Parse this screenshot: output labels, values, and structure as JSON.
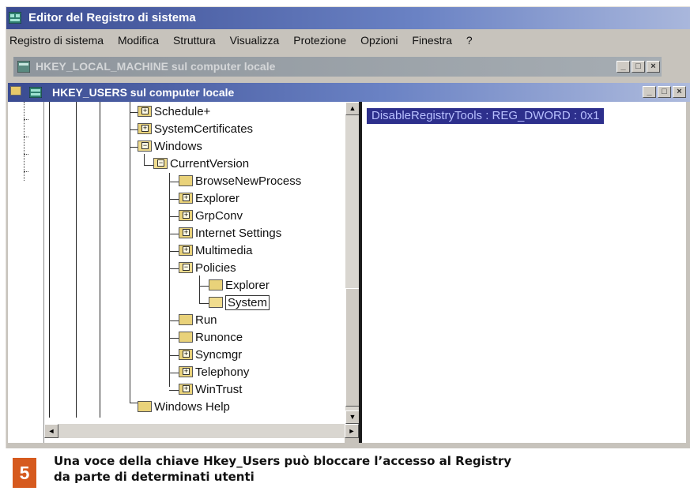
{
  "window": {
    "title": "Editor del Registro di sistema",
    "menu": [
      "Registro di sistema",
      "Modifica",
      "Struttura",
      "Visualizza",
      "Protezione",
      "Opzioni",
      "Finestra",
      "?"
    ]
  },
  "bg_window": {
    "title": "HKEY_LOCAL_MACHINE sul computer locale"
  },
  "fg_window": {
    "title": "HKEY_USERS sul computer locale"
  },
  "controls": {
    "minimize": "_",
    "maximize": "□",
    "close": "×"
  },
  "tree": [
    {
      "label": "Schedule+",
      "icon": "folder-plus-icon"
    },
    {
      "label": "SystemCertificates",
      "icon": "folder-plus-icon"
    },
    {
      "label": "Windows",
      "icon": "folder-open-icon"
    },
    {
      "label": "CurrentVersion",
      "icon": "folder-open-icon"
    },
    {
      "label": "BrowseNewProcess",
      "icon": "folder-icon"
    },
    {
      "label": "Explorer",
      "icon": "folder-icon"
    },
    {
      "label": "GrpConv",
      "icon": "folder-plus-icon"
    },
    {
      "label": "Internet Settings",
      "icon": "folder-plus-icon"
    },
    {
      "label": "Multimedia",
      "icon": "folder-plus-icon"
    },
    {
      "label": "Policies",
      "icon": "folder-open-icon"
    },
    {
      "label": "Explorer",
      "icon": "folder-icon"
    },
    {
      "label": "System",
      "icon": "folder-open-icon",
      "selected": true
    },
    {
      "label": "Run",
      "icon": "folder-icon"
    },
    {
      "label": "Runonce",
      "icon": "folder-icon"
    },
    {
      "label": "Syncmgr",
      "icon": "folder-plus-icon"
    },
    {
      "label": "Telephony",
      "icon": "folder-plus-icon"
    },
    {
      "label": "WinTrust",
      "icon": "folder-plus-icon"
    },
    {
      "label": "Windows Help",
      "icon": "folder-icon"
    }
  ],
  "values": [
    {
      "text": "DisableRegistryTools : REG_DWORD : 0x1",
      "selected": true
    }
  ],
  "scroll": {
    "up": "▲",
    "down": "▼",
    "left": "◄",
    "right": "►"
  },
  "caption": {
    "number": "5",
    "line1": "Una voce della chiave Hkey_Users può bloccare l’accesso al Registry",
    "line2": "da parte di determinati utenti"
  }
}
